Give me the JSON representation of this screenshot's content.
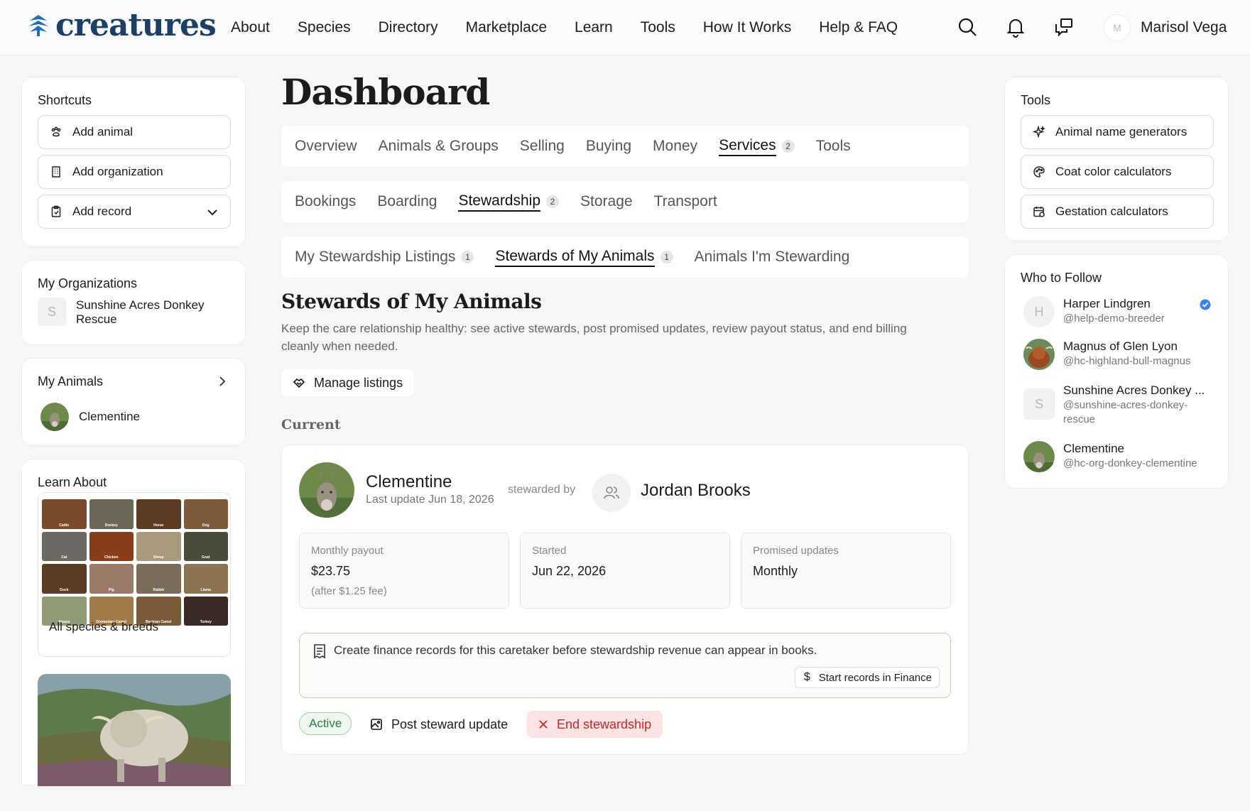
{
  "brand": {
    "name": "creatures"
  },
  "nav": {
    "items": [
      "About",
      "Species",
      "Directory",
      "Marketplace",
      "Learn",
      "Tools",
      "How It Works",
      "Help & FAQ"
    ]
  },
  "user": {
    "initial": "M",
    "name": "Marisol Vega"
  },
  "shortcuts": {
    "title": "Shortcuts",
    "items": [
      {
        "label": "Add animal",
        "icon": "paw-icon"
      },
      {
        "label": "Add organization",
        "icon": "building-icon"
      },
      {
        "label": "Add record",
        "icon": "clipboard-icon"
      }
    ]
  },
  "organizations": {
    "title": "My Organizations",
    "items": [
      {
        "initial": "S",
        "name": "Sunshine Acres Donkey Rescue"
      }
    ]
  },
  "animals": {
    "title": "My Animals",
    "items": [
      {
        "name": "Clementine"
      }
    ]
  },
  "learn": {
    "title": "Learn About",
    "species": [
      "Cattle",
      "Donkey",
      "Horse",
      "Dog",
      "Cat",
      "Chicken",
      "Sheep",
      "Goat",
      "Duck",
      "Pig",
      "Rabbit",
      "Llama",
      "Alpaca",
      "Dromedary Camel",
      "Bactrian Camel",
      "Turkey"
    ],
    "link": "All species & breeds"
  },
  "page": {
    "title": "Dashboard"
  },
  "tabs_primary": [
    {
      "label": "Overview"
    },
    {
      "label": "Animals & Groups"
    },
    {
      "label": "Selling"
    },
    {
      "label": "Buying"
    },
    {
      "label": "Money"
    },
    {
      "label": "Services",
      "badge": "2",
      "active": true
    },
    {
      "label": "Tools"
    }
  ],
  "tabs_secondary": [
    {
      "label": "Bookings"
    },
    {
      "label": "Boarding"
    },
    {
      "label": "Stewardship",
      "badge": "2",
      "active": true
    },
    {
      "label": "Storage"
    },
    {
      "label": "Transport"
    }
  ],
  "tabs_tertiary": [
    {
      "label": "My Stewardship Listings",
      "badge": "1"
    },
    {
      "label": "Stewards of My Animals",
      "badge": "1",
      "active": true
    },
    {
      "label": "Animals I'm Stewarding"
    }
  ],
  "section": {
    "title": "Stewards of My Animals",
    "description": "Keep the care relationship healthy: see active stewards, post promised updates, review payout status, and end billing cleanly when needed.",
    "manage_label": "Manage listings",
    "current_label": "Current"
  },
  "stewardship": {
    "animal_name": "Clementine",
    "last_update": "Last update Jun 18, 2026",
    "stewarded_by": "stewarded by",
    "steward_name": "Jordan Brooks",
    "stats": [
      {
        "label": "Monthly payout",
        "value": "$23.75",
        "note": "(after $1.25 fee)"
      },
      {
        "label": "Started",
        "value": "Jun 22, 2026"
      },
      {
        "label": "Promised updates",
        "value": "Monthly"
      }
    ],
    "notice": "Create finance records for this caretaker before stewardship revenue can appear in books.",
    "notice_button": "Start records in Finance",
    "status": "Active",
    "post_update": "Post steward update",
    "end": "End stewardship"
  },
  "tools": {
    "title": "Tools",
    "items": [
      {
        "label": "Animal name generators",
        "icon": "sparkle-icon"
      },
      {
        "label": "Coat color calculators",
        "icon": "palette-icon"
      },
      {
        "label": "Gestation calculators",
        "icon": "calendar-icon"
      }
    ]
  },
  "follow": {
    "title": "Who to Follow",
    "items": [
      {
        "name": "Harper Lindgren",
        "handle": "@help-demo-breeder",
        "initial": "H",
        "verified": true
      },
      {
        "name": "Magnus of Glen Lyon",
        "handle": "@hc-highland-bull-magnus"
      },
      {
        "name": "Sunshine Acres Donkey ...",
        "handle": "@sunshine-acres-donkey-rescue",
        "initial": "S"
      },
      {
        "name": "Clementine",
        "handle": "@hc-org-donkey-clementine"
      }
    ]
  },
  "colors": {
    "brand": "#1d3f66",
    "danger": "#c62828",
    "success": "#2e7d42",
    "verified": "#3b82f6"
  }
}
